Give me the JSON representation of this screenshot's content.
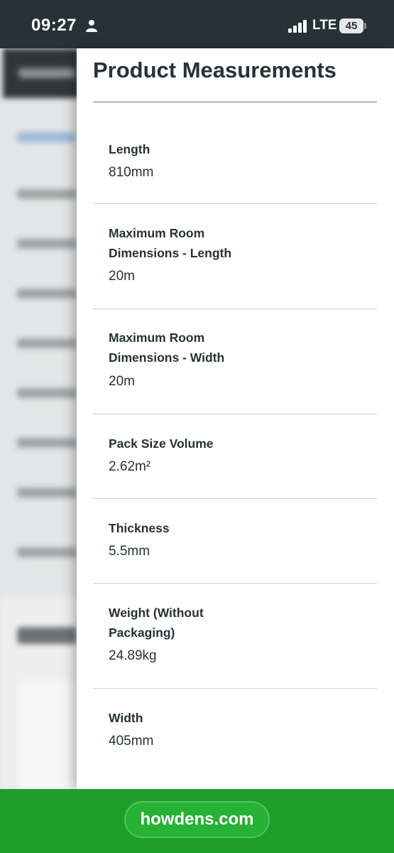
{
  "status_bar": {
    "time": "09:27",
    "network": "LTE",
    "battery": "45"
  },
  "drawer": {
    "title": "Product Measurements",
    "rows": [
      {
        "label": "Length",
        "value": "810mm"
      },
      {
        "label": "Maximum Room Dimensions - Length",
        "value": "20m"
      },
      {
        "label": "Maximum Room Dimensions - Width",
        "value": "20m"
      },
      {
        "label": "Pack Size Volume",
        "value": "2.62m²"
      },
      {
        "label": "Thickness",
        "value": "5.5mm"
      },
      {
        "label": "Weight (Without Packaging)",
        "value": "24.89kg"
      },
      {
        "label": "Width",
        "value": "405mm"
      }
    ]
  },
  "url_bar": {
    "domain": "howdens.com"
  },
  "colors": {
    "status_bar_bg": "#263238",
    "text_dark": "#263238",
    "url_bar_green": "#1f9e2c"
  }
}
